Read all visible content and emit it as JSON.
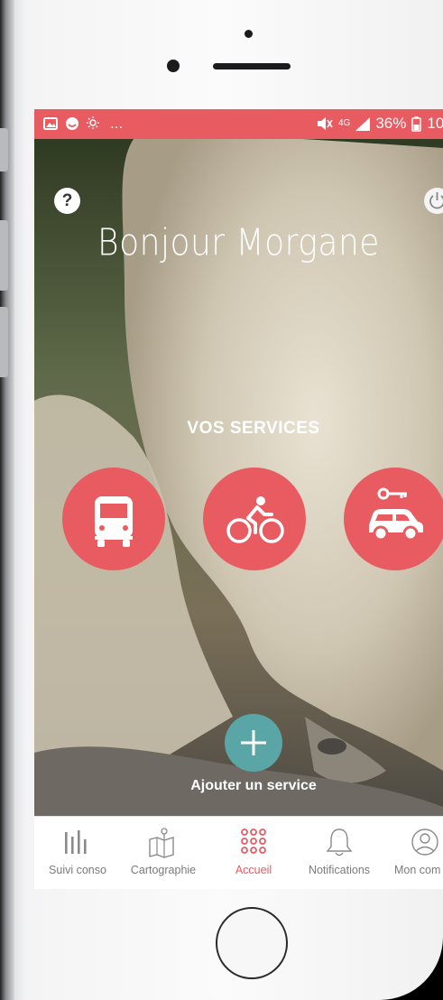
{
  "status_bar": {
    "left_icons": [
      "image-icon",
      "face-icon",
      "weather-icon"
    ],
    "left_more": "...",
    "right_text": "36%",
    "network_label": "4G",
    "time": "10:"
  },
  "header": {
    "help_label": "?",
    "greeting": "Bonjour Morgane"
  },
  "services": {
    "title": "VOS SERVICES",
    "items": [
      {
        "icon": "bus-icon"
      },
      {
        "icon": "bicycle-icon"
      },
      {
        "icon": "car-key-icon"
      }
    ],
    "add_label": "Ajouter un service"
  },
  "tabbar": {
    "items": [
      {
        "label": "Suivi conso",
        "icon": "bars-icon",
        "active": false
      },
      {
        "label": "Cartographie",
        "icon": "map-icon",
        "active": false
      },
      {
        "label": "Accueil",
        "icon": "grid-dots-icon",
        "active": true
      },
      {
        "label": "Notifications",
        "icon": "bell-icon",
        "active": false
      },
      {
        "label": "Mon com",
        "icon": "user-icon",
        "active": false
      }
    ]
  },
  "colors": {
    "accent": "#e85b60",
    "add_button": "#5aa6a6",
    "tab_inactive": "#7a7a7a"
  }
}
